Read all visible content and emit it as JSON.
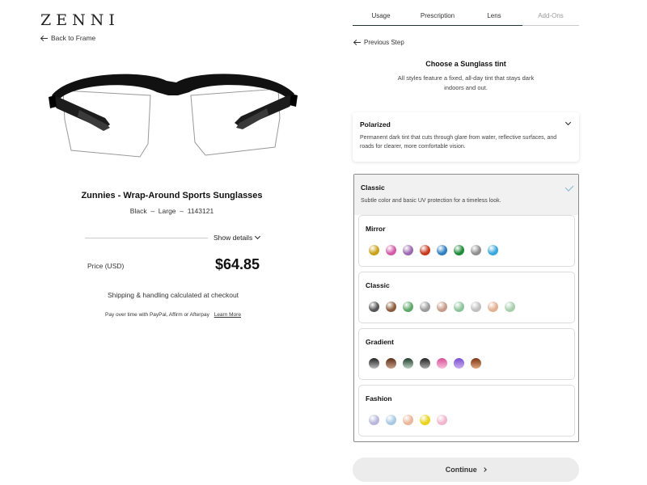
{
  "brand": {
    "name": "ZENNI"
  },
  "nav": {
    "back_to_frame": "Back to Frame"
  },
  "product": {
    "name": "Zunnies - Wrap-Around Sports Sunglasses",
    "color": "Black",
    "size": "Large",
    "sku": "1143121",
    "show_details": "Show details",
    "price_label": "Price  (USD)",
    "price": "$64.85",
    "shipping_note": "Shipping & handling calculated at checkout",
    "pay_over_time": "Pay over time with PayPal, Affirm or Afterpay",
    "learn_more": "Learn More"
  },
  "steps": {
    "tabs": [
      "Usage",
      "Prescription",
      "Lens",
      "Add-Ons"
    ],
    "previous_step": "Previous Step"
  },
  "tint": {
    "title": "Choose a Sunglass tint",
    "description": "All styles feature a fixed, all-day tint that stays dark indoors and out."
  },
  "options": {
    "polarized": {
      "title": "Polarized",
      "description": "Permanent dark tint that cuts through glare from water, reflective surfaces, and roads for clearer, more comfortable vision."
    },
    "classic": {
      "title": "Classic",
      "description": "Subtle color and basic UV protection for a timeless look.",
      "selected": true
    }
  },
  "tint_groups": [
    {
      "name": "Mirror",
      "swatches": [
        {
          "name": "gold",
          "color": "#c9a21a"
        },
        {
          "name": "pink",
          "color": "#d25aa6"
        },
        {
          "name": "purple",
          "color": "#9b6ab0"
        },
        {
          "name": "red",
          "color": "#c8391c"
        },
        {
          "name": "blue",
          "color": "#2f7fc1"
        },
        {
          "name": "green",
          "color": "#1f8a3a"
        },
        {
          "name": "silver",
          "color": "#8f8f8f"
        },
        {
          "name": "ice blue",
          "color": "#37a7dc"
        }
      ]
    },
    {
      "name": "Classic",
      "swatches": [
        {
          "name": "gray",
          "color": "#555555"
        },
        {
          "name": "brown",
          "color": "#8b5a3c"
        },
        {
          "name": "green",
          "color": "#5fa86a"
        },
        {
          "name": "light gray",
          "color": "#9a9a9a"
        },
        {
          "name": "rose",
          "color": "#c79a8a"
        },
        {
          "name": "mint",
          "color": "#8cc49a"
        },
        {
          "name": "pale gray",
          "color": "#bfbfbf"
        },
        {
          "name": "peach",
          "color": "#e2b08f"
        },
        {
          "name": "sage",
          "color": "#a7cfae"
        }
      ]
    },
    {
      "name": "Gradient",
      "swatches": [
        {
          "name": "gray gradient",
          "color": "linear-gradient(#222,#bbb)"
        },
        {
          "name": "brown gradient",
          "color": "linear-gradient(#5a2d18,#c9a08a)"
        },
        {
          "name": "green gradient",
          "color": "linear-gradient(#1f3a2a,#bcd3c4)"
        },
        {
          "name": "dark gradient",
          "color": "linear-gradient(#222,#aaa)"
        },
        {
          "name": "pink gradient",
          "color": "linear-gradient(#d84d97,#f6c1dc)"
        },
        {
          "name": "purple gradient",
          "color": "linear-gradient(#7a4cd0,#c9b2f0)"
        },
        {
          "name": "amber gradient",
          "color": "linear-gradient(#7a3311,#e0a77e)"
        }
      ]
    },
    {
      "name": "Fashion",
      "swatches": [
        {
          "name": "lavender",
          "color": "#b9b6dc"
        },
        {
          "name": "light blue",
          "color": "#a9c9e2"
        },
        {
          "name": "apricot",
          "color": "#e9b79a"
        },
        {
          "name": "yellow",
          "color": "#e8d21c"
        },
        {
          "name": "light pink",
          "color": "#f0b6cc"
        }
      ]
    }
  ],
  "actions": {
    "continue": "Continue"
  }
}
